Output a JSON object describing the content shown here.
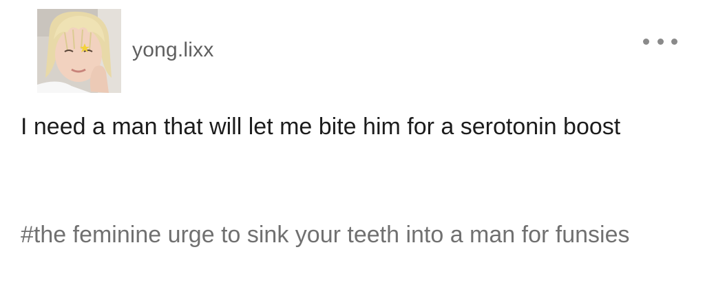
{
  "post": {
    "username": "yong.lixx",
    "body": "I need a man that will let me bite him for a serotonin boost",
    "tags": "#the feminine urge to sink your teeth into a man for funsies"
  },
  "icons": {
    "avatar": "avatar",
    "more": "more-options-icon"
  },
  "colors": {
    "username": "#5f5f5f",
    "body_text": "#1c1c1c",
    "tag_text": "#707070",
    "dots": "#8a8a8a",
    "background": "#ffffff"
  }
}
